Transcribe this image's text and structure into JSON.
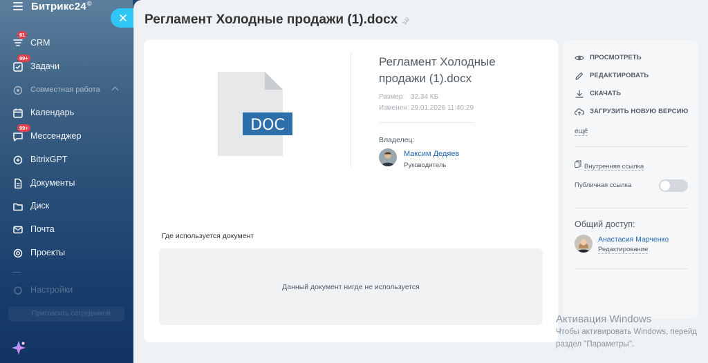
{
  "app": {
    "logo_text": "Битрикс24",
    "logo_mark": "©"
  },
  "sidebar": {
    "items": [
      {
        "label": "CRM",
        "badge": "61",
        "icon": "crm-funnel-icon"
      },
      {
        "label": "Задачи",
        "badge": "99+",
        "icon": "tasks-checkbox-icon"
      },
      {
        "label": "Совместная работа",
        "icon": "collab-icon"
      },
      {
        "label": "Календарь",
        "icon": "calendar-icon"
      },
      {
        "label": "Мессенджер",
        "badge": "99+",
        "icon": "messenger-icon"
      },
      {
        "label": "BitrixGPT",
        "icon": "bitrixgpt-icon"
      },
      {
        "label": "Документы",
        "icon": "documents-icon"
      },
      {
        "label": "Диск",
        "icon": "disk-icon"
      },
      {
        "label": "Почта",
        "icon": "mail-icon"
      },
      {
        "label": "Проекты",
        "icon": "projects-icon"
      },
      {
        "label": "Настройки",
        "icon": "settings-icon"
      }
    ],
    "bottom_button_label": "Пригласить сотрудников"
  },
  "document": {
    "title": "Регламент Холодные продажи (1).docx",
    "file_name": "Регламент Холодные продажи (1).docx",
    "file_type_label": "DOC",
    "size_label": "Размер:",
    "size_value": "32.34 КБ",
    "modified_label": "Изменен:",
    "modified_value": "29.01.2026 11:40:29",
    "owner_label": "Владелец:",
    "owner_name": "Максим Дедяев",
    "owner_role": "Руководитель"
  },
  "usage": {
    "label": "Где используется документ",
    "empty_text": "Данный документ нигде не используется"
  },
  "actions": {
    "view": "ПРОСМОТРЕТЬ",
    "edit": "РЕДАКТИРОВАТЬ",
    "download": "СКАЧАТЬ",
    "upload": "ЗАГРУЗИТЬ НОВУЮ ВЕРСИЮ",
    "more": "ещё"
  },
  "links": {
    "internal_link": "Внутренняя ссылка",
    "public_link": "Публичная ссылка",
    "public_link_enabled": false
  },
  "sharing": {
    "label": "Общий доступ:",
    "user_name": "Анастасия Марченко",
    "user_permission": "Редактирование"
  },
  "watermark": {
    "title": "Активация Windows",
    "line1": "Чтобы активировать Windows, перейд",
    "line2": "раздел \"Параметры\"."
  },
  "colors": {
    "accent": "#2fc6f6",
    "link": "#2067b0",
    "badge": "#e0434e",
    "doc_blue": "#2c6fab"
  }
}
